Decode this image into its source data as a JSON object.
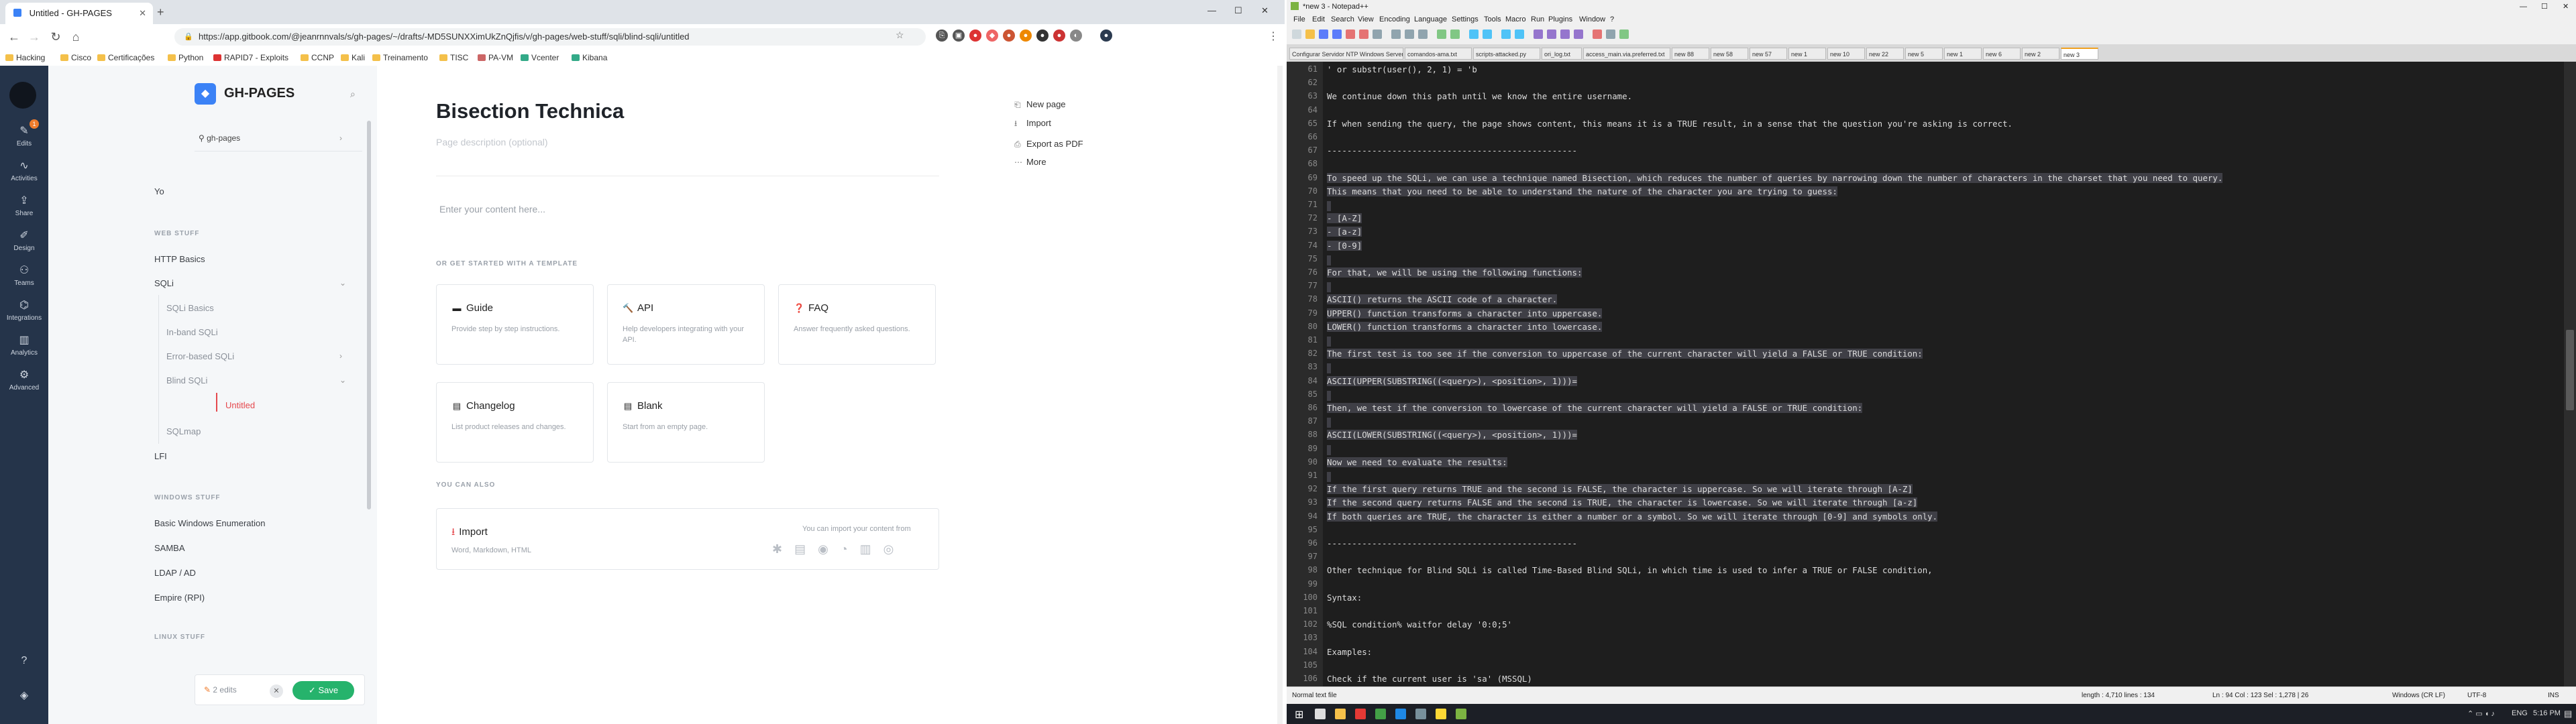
{
  "browser": {
    "tab_title": "Untitled - GH-PAGES",
    "new_tab": "+",
    "url": "https://app.gitbook.com/@jeanrnnvals/s/gh-pages/~/drafts/-MD5SUNXXimUkZnQjfis/v/gh-pages/web-stuff/sqli/blind-sqli/untitled",
    "bookmarks": [
      "Hacking",
      "Cisco",
      "Certificações",
      "Python",
      "RAPID7 - Exploits",
      "CCNP",
      "Kali",
      "Treinamento",
      "TISC",
      "PA-VM",
      "Vcenter",
      "Kibana"
    ]
  },
  "rail": {
    "items": [
      "Edits",
      "Activities",
      "Share",
      "Design",
      "Teams",
      "Integrations",
      "Analytics",
      "Advanced"
    ],
    "badge": "1"
  },
  "sidebar": {
    "space_title": "GH-PAGES",
    "variant": "gh-pages",
    "items": {
      "yo": "Yo",
      "web_head": "WEB STUFF",
      "http": "HTTP Basics",
      "sqli": "SQLi",
      "sqli_basics": "SQLi Basics",
      "inband": "In-band SQLi",
      "error": "Error-based SQLi",
      "blind": "Blind SQLi",
      "untitled": "Untitled",
      "sqlmap": "SQLmap",
      "lfi": "LFI",
      "windows_head": "WINDOWS STUFF",
      "basic_win": "Basic Windows Enumeration",
      "samba": "SAMBA",
      "ldap": "LDAP / AD",
      "empire": "Empire (RPI)",
      "linux_head": "LINUX STUFF"
    },
    "edits": "2 edits",
    "save": "Save"
  },
  "editor": {
    "title": "Bisection Technica",
    "description_placeholder": "Page description (optional)",
    "content_placeholder": "Enter your content here...",
    "template_head": "OR GET STARTED WITH A TEMPLATE",
    "cards": [
      {
        "icon": "▬",
        "title": "Guide",
        "desc": "Provide step by step instructions."
      },
      {
        "icon": "🔨",
        "title": "API",
        "desc": "Help developers integrating with your API."
      },
      {
        "icon": "❓",
        "title": "FAQ",
        "desc": "Answer frequently asked questions."
      },
      {
        "icon": "▤",
        "title": "Changelog",
        "desc": "List product releases and changes."
      },
      {
        "icon": "▤",
        "title": "Blank",
        "desc": "Start from an empty page."
      }
    ],
    "also_head": "YOU CAN ALSO",
    "import_title": "Import",
    "import_desc": "Word, Markdown, HTML",
    "import_hint": "You can import your content from",
    "actions": [
      "New page",
      "Import",
      "Export as PDF",
      "More"
    ]
  },
  "npp": {
    "title": "*new 3 - Notepad++",
    "menu": [
      "File",
      "Edit",
      "Search",
      "View",
      "Encoding",
      "Language",
      "Settings",
      "Tools",
      "Macro",
      "Run",
      "Plugins",
      "Window",
      "?"
    ],
    "tabs": [
      "Configurar Servidor NTP Windows Server 2008 R2 com Cisco.txt",
      "comandos-ama.txt",
      "scripts-attacked.py",
      "ori_log.txt",
      "access_main.via.preferred.txt",
      "new 88",
      "new 58",
      "new 57",
      "new 1",
      "new 10",
      "new 22",
      "new 5",
      "new 1",
      "new 6",
      "new 2",
      "new 3"
    ],
    "lines": [
      {
        "n": "61",
        "t": "' or substr(user(), 2, 1) = 'b",
        "sel": false
      },
      {
        "n": "62",
        "t": "",
        "sel": false
      },
      {
        "n": "63",
        "t": "We continue down this path until we know the entire username.",
        "sel": false
      },
      {
        "n": "64",
        "t": "",
        "sel": false
      },
      {
        "n": "65",
        "t": "If when sending the query, the page shows content, this means it is a TRUE result, in a sense that the question you're asking is correct.",
        "sel": false
      },
      {
        "n": "66",
        "t": "",
        "sel": false
      },
      {
        "n": "67",
        "t": "--------------------------------------------------",
        "sel": false
      },
      {
        "n": "68",
        "t": "",
        "sel": false
      },
      {
        "n": "69",
        "t": "To speed up the SQLi, we can use a technique named Bisection, which reduces the number of queries by narrowing down the number of characters in the charset that you need to query.",
        "sel": true
      },
      {
        "n": "70",
        "t": "This means that you need to be able to understand the nature of the character you are trying to guess:",
        "sel": true
      },
      {
        "n": "71",
        "t": "",
        "sel": true
      },
      {
        "n": "72",
        "t": "- [A-Z]",
        "sel": true
      },
      {
        "n": "73",
        "t": "- [a-z]",
        "sel": true
      },
      {
        "n": "74",
        "t": "- [0-9]",
        "sel": true
      },
      {
        "n": "75",
        "t": "",
        "sel": true
      },
      {
        "n": "76",
        "t": "For that, we will be using the following functions:",
        "sel": true
      },
      {
        "n": "77",
        "t": "",
        "sel": true
      },
      {
        "n": "78",
        "t": "ASCII() returns the ASCII code of a character.",
        "sel": true
      },
      {
        "n": "79",
        "t": "UPPER() function transforms a character into uppercase.",
        "sel": true
      },
      {
        "n": "80",
        "t": "LOWER() function transforms a character into lowercase.",
        "sel": true
      },
      {
        "n": "81",
        "t": "",
        "sel": true
      },
      {
        "n": "82",
        "t": "The first test is too see if the conversion to uppercase of the current character will yield a FALSE or TRUE condition:",
        "sel": true
      },
      {
        "n": "83",
        "t": "",
        "sel": true
      },
      {
        "n": "84",
        "t": "ASCII(UPPER(SUBSTRING((<query>), <position>, 1)))=",
        "sel": true
      },
      {
        "n": "85",
        "t": "",
        "sel": true
      },
      {
        "n": "86",
        "t": "Then, we test if the conversion to lowercase of the current character will yield a FALSE or TRUE condition:",
        "sel": true
      },
      {
        "n": "87",
        "t": "",
        "sel": true
      },
      {
        "n": "88",
        "t": "ASCII(LOWER(SUBSTRING((<query>), <position>, 1)))=",
        "sel": true
      },
      {
        "n": "89",
        "t": "",
        "sel": true
      },
      {
        "n": "90",
        "t": "Now we need to evaluate the results:",
        "sel": true
      },
      {
        "n": "91",
        "t": "",
        "sel": true
      },
      {
        "n": "92",
        "t": "If the first query returns TRUE and the second is FALSE, the character is uppercase. So we will iterate through [A-Z]",
        "sel": true
      },
      {
        "n": "93",
        "t": "If the second query returns FALSE and the second is TRUE, the character is lowercase. So we will iterate through [a-z]",
        "sel": true
      },
      {
        "n": "94",
        "t": "If both queries are TRUE, the character is either a number or a symbol. So we will iterate through [0-9] and symbols only.",
        "sel": true
      },
      {
        "n": "95",
        "t": "",
        "sel": false
      },
      {
        "n": "96",
        "t": "--------------------------------------------------",
        "sel": false
      },
      {
        "n": "97",
        "t": "",
        "sel": false
      },
      {
        "n": "98",
        "t": "Other technique for Blind SQLi is called Time-Based Blind SQLi, in which time is used to infer a TRUE or FALSE condition,",
        "sel": false
      },
      {
        "n": "99",
        "t": "",
        "sel": false
      },
      {
        "n": "100",
        "t": "Syntax:",
        "sel": false
      },
      {
        "n": "101",
        "t": "",
        "sel": false
      },
      {
        "n": "102",
        "t": "%SQL condition% waitfor delay '0:0;5'",
        "sel": false
      },
      {
        "n": "103",
        "t": "",
        "sel": false
      },
      {
        "n": "104",
        "t": "Examples:",
        "sel": false
      },
      {
        "n": "105",
        "t": "",
        "sel": false
      },
      {
        "n": "106",
        "t": "Check if the current user is 'sa' (MSSQL)",
        "sel": false
      }
    ],
    "status": {
      "type": "Normal text file",
      "length": "length : 4,710    lines : 134",
      "pos": "Ln : 94    Col : 123    Sel : 1,278 | 26",
      "eol": "Windows (CR LF)",
      "enc": "UTF-8",
      "mode": "INS"
    }
  },
  "taskbar": {
    "lang": "ENG",
    "time": "5:16 PM"
  }
}
